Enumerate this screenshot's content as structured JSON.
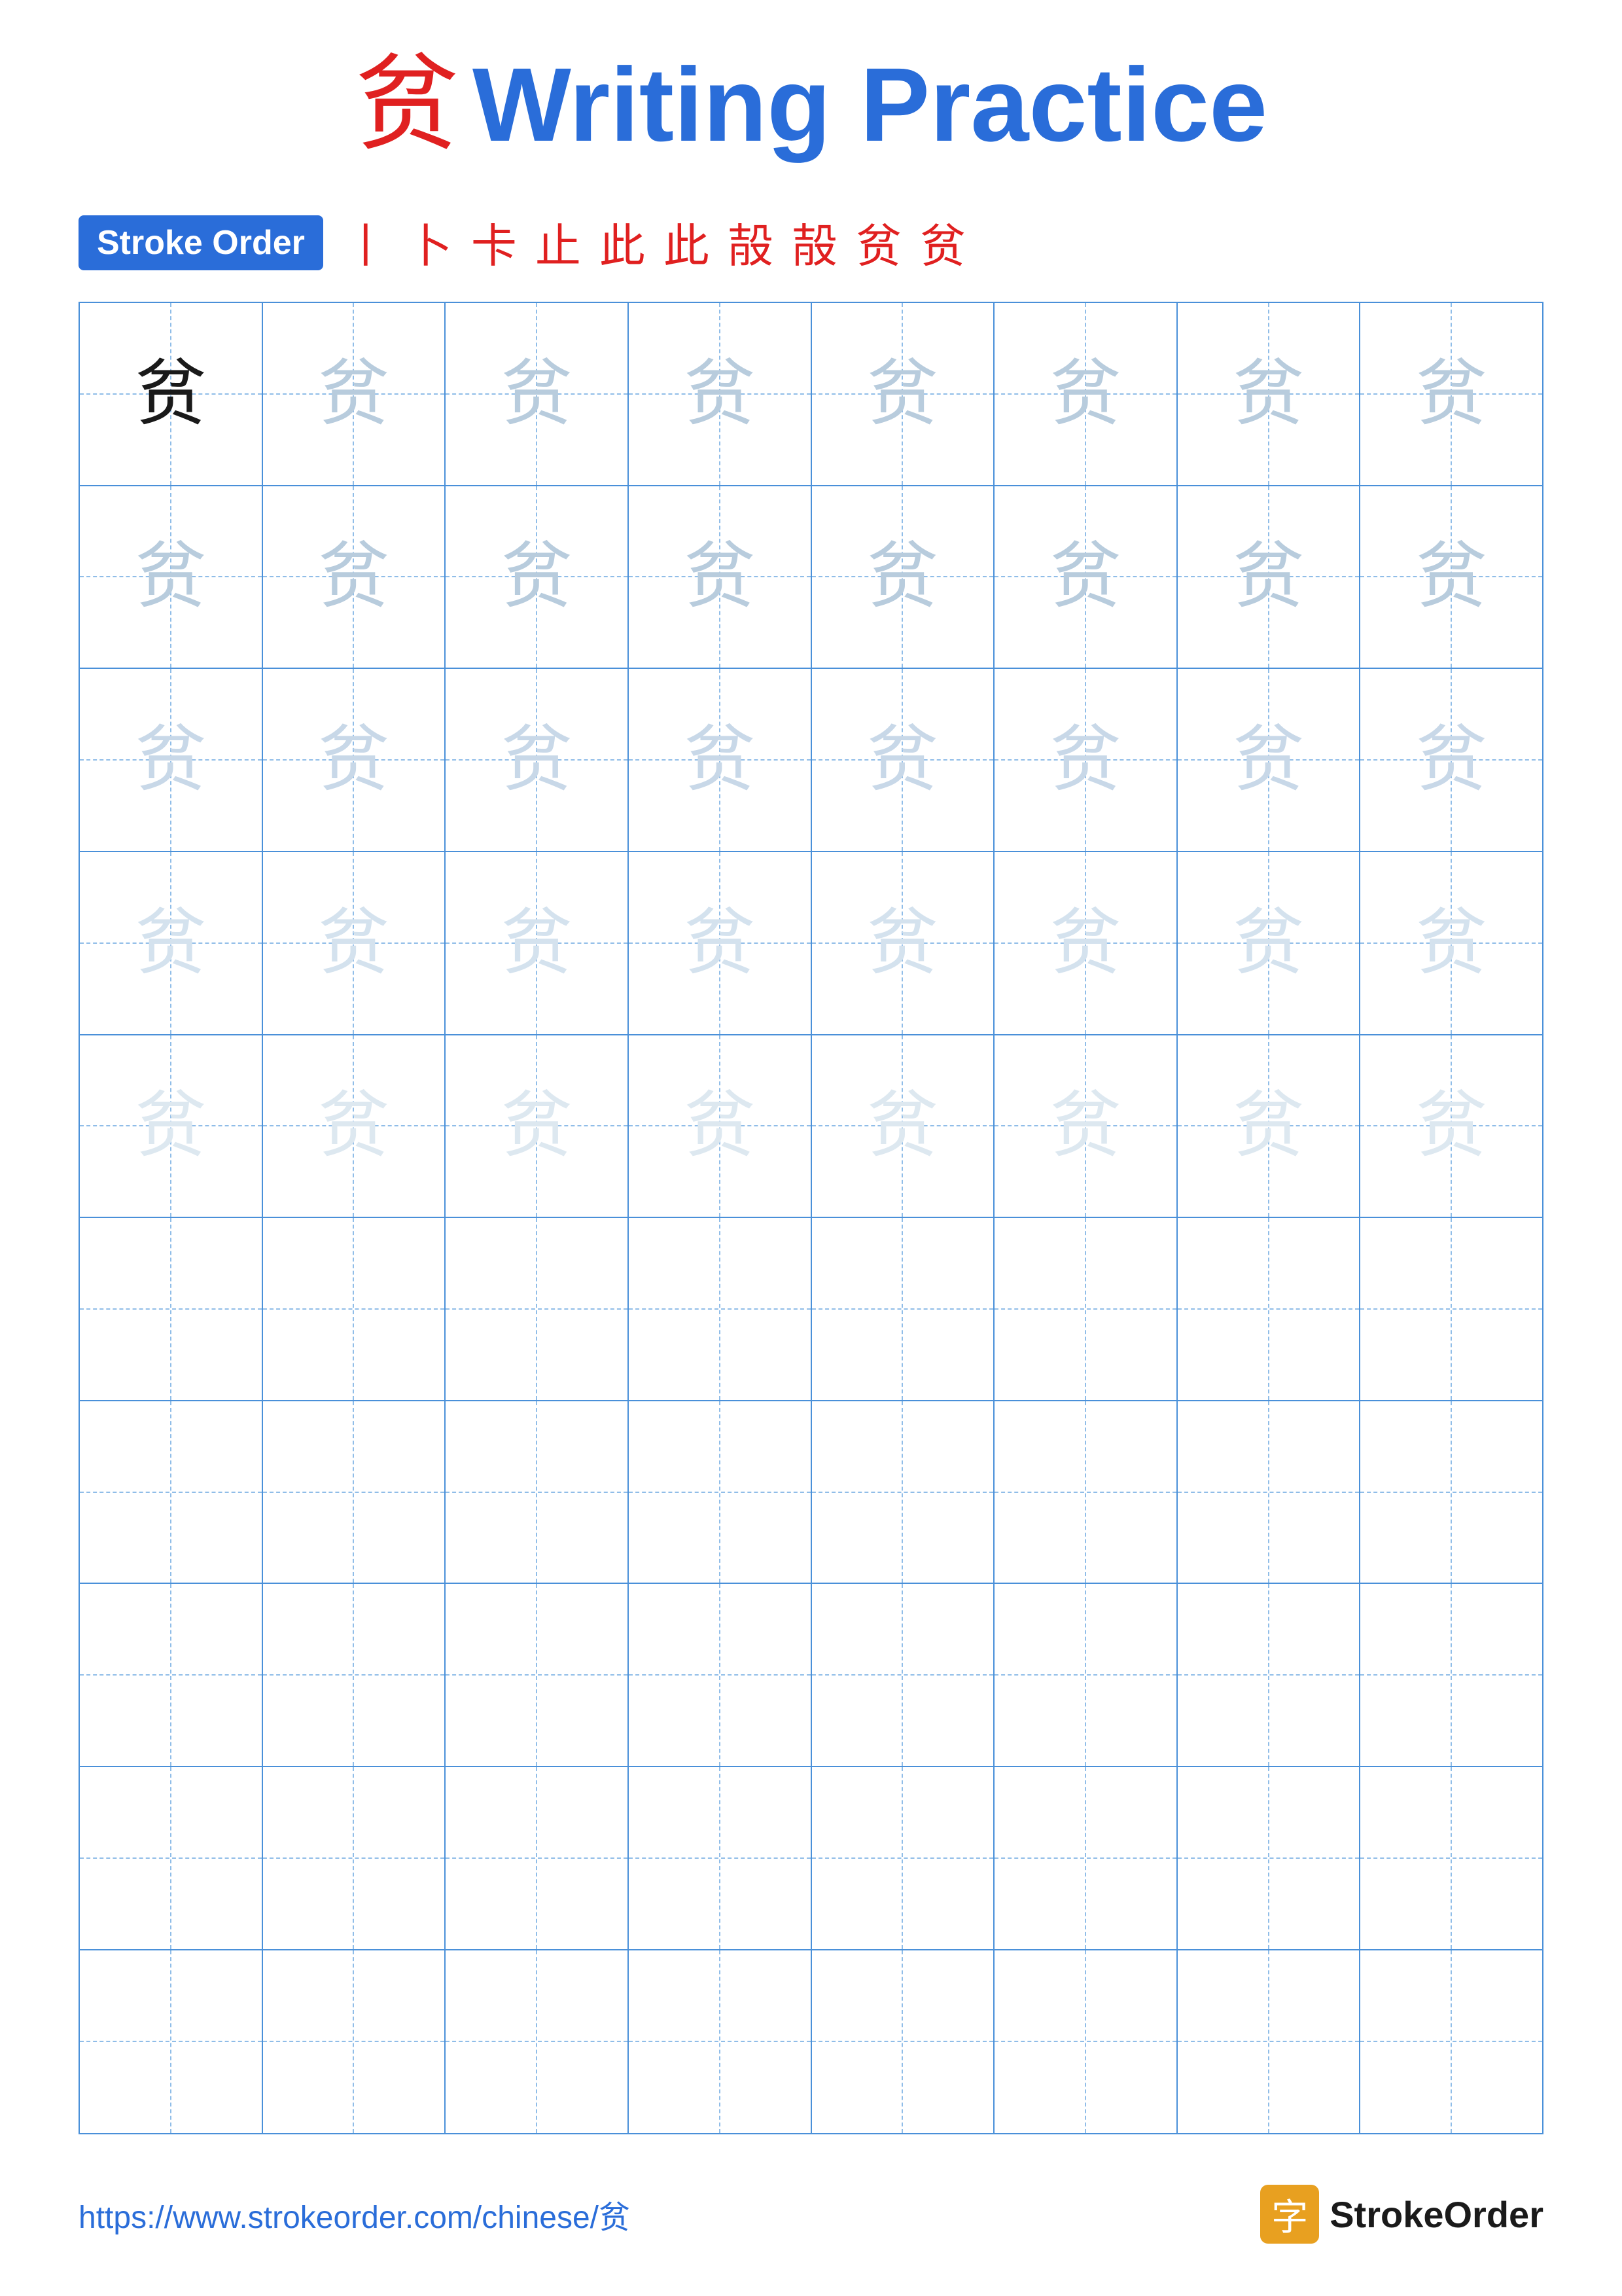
{
  "title": {
    "char": "贫",
    "text": "Writing Practice"
  },
  "stroke_order": {
    "badge_label": "Stroke Order",
    "strokes": [
      "丨",
      "卜",
      "卡",
      "止",
      "此",
      "此",
      "㱿",
      "㱿",
      "贫",
      "贫"
    ]
  },
  "grid": {
    "rows": 10,
    "cols": 8,
    "char": "贫",
    "row_styles": [
      "dark",
      "light1",
      "light1",
      "light2",
      "light3",
      "empty",
      "empty",
      "empty",
      "empty",
      "empty"
    ]
  },
  "footer": {
    "url": "https://www.strokeorder.com/chinese/贫",
    "brand_char": "字",
    "brand_name": "StrokeOrder"
  }
}
